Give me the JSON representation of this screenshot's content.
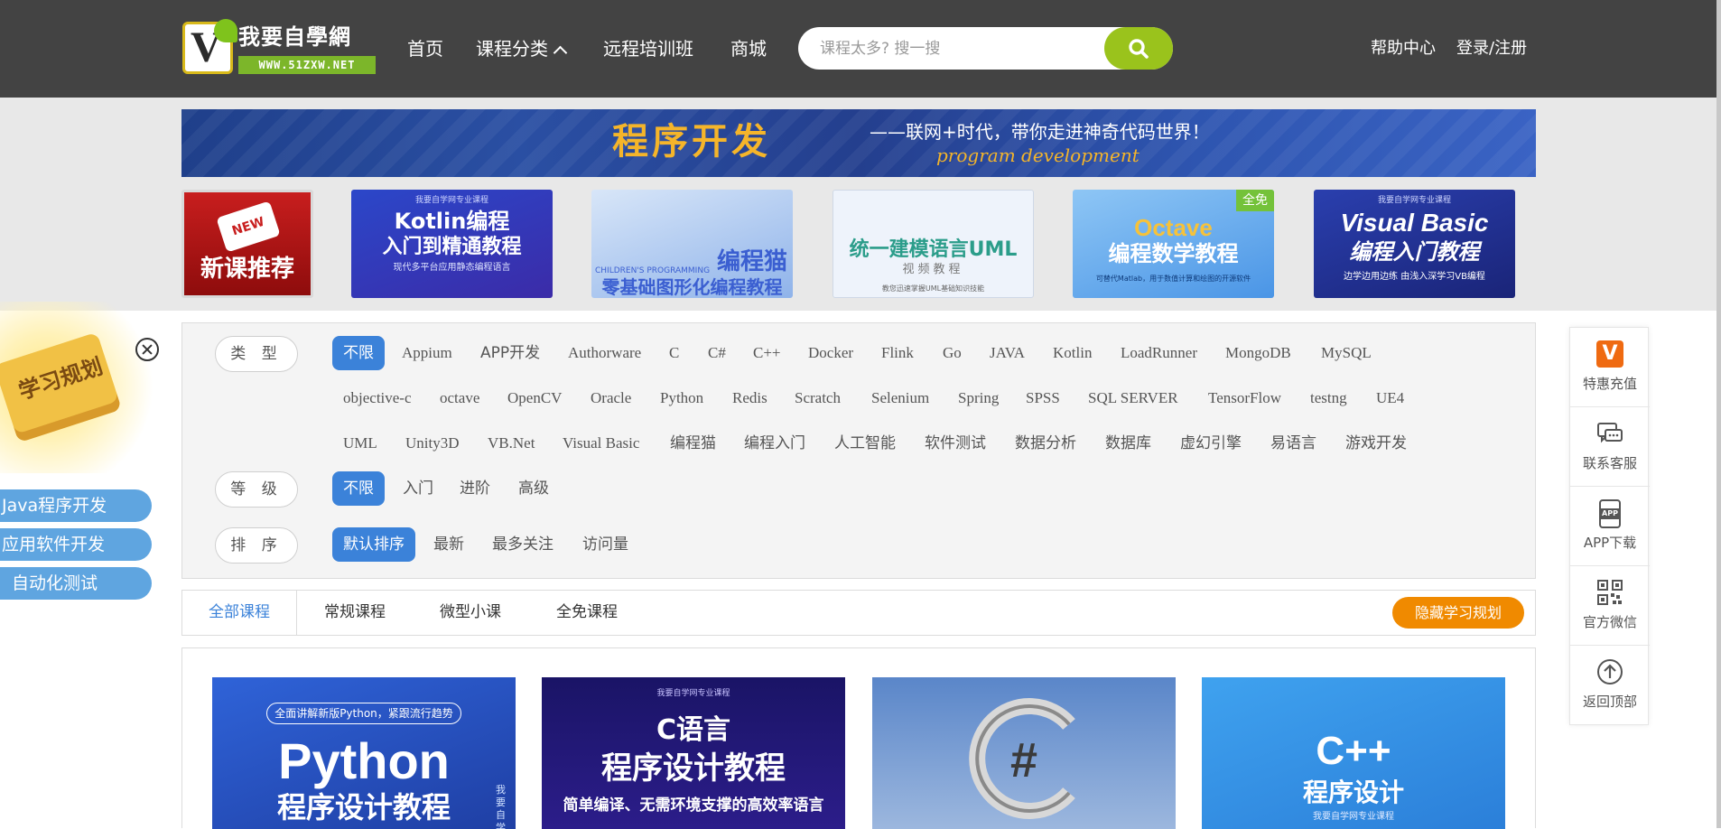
{
  "header": {
    "logo": {
      "name": "我要自學網",
      "url": "WWW.51ZXW.NET"
    },
    "nav": [
      {
        "label": "首页"
      },
      {
        "label": "课程分类"
      },
      {
        "label": "远程培训班"
      },
      {
        "label": "商城"
      }
    ],
    "search": {
      "placeholder": "课程太多? 搜一搜"
    },
    "help": "帮助中心",
    "login": "登录/注册"
  },
  "banner": {
    "title": "程序开发",
    "subtitle": "——联网+时代，带你走进神奇代码世界！",
    "subtitle_en": "program development"
  },
  "thumbnails": [
    {
      "tag": "NEW",
      "label": "新课推荐"
    },
    {
      "line1": "Kotlin编程",
      "line2": "入门到精通教程",
      "line3": "现代多平台应用静态编程语言",
      "top": "我要自学网专业课程"
    },
    {
      "line1": "编程猫",
      "line2": "零基础图形化编程教程",
      "line3": "CHILDREN'S PROGRAMMING"
    },
    {
      "line1": "统一建模语言UML",
      "line2": "视频教程",
      "line3": "教您迅速掌握UML基础知识技能"
    },
    {
      "line1": "Octave",
      "line2": "编程数学教程",
      "line3": "可替代Matlab，用于数值计算和绘图的开源软件",
      "badge": "全免"
    },
    {
      "line1": "Visual Basic",
      "line2": "编程入门教程",
      "line3": "边学边用边练 由浅入深学习VB编程",
      "top": "我要自学网专业课程"
    }
  ],
  "plan": {
    "book": "学习规划",
    "items": [
      "Java程序开发",
      "应用软件开发",
      "自动化测试"
    ]
  },
  "filters": {
    "type_label": "类 型",
    "types": [
      "不限",
      "Appium",
      "APP开发",
      "Authorware",
      "C",
      "C#",
      "C++",
      "Docker",
      "Flink",
      "Go",
      "JAVA",
      "Kotlin",
      "LoadRunner",
      "MongoDB",
      "MySQL",
      "objective-c",
      "octave",
      "OpenCV",
      "Oracle",
      "Python",
      "Redis",
      "Scratch",
      "Selenium",
      "Spring",
      "SPSS",
      "SQL SERVER",
      "TensorFlow",
      "testng",
      "UE4",
      "UML",
      "Unity3D",
      "VB.Net",
      "Visual Basic",
      "编程猫",
      "编程入门",
      "人工智能",
      "软件测试",
      "数据分析",
      "数据库",
      "虚幻引擎",
      "易语言",
      "游戏开发"
    ],
    "level_label": "等 级",
    "levels": [
      "不限",
      "入门",
      "进阶",
      "高级"
    ],
    "sort_label": "排 序",
    "sorts": [
      "默认排序",
      "最新",
      "最多关注",
      "访问量"
    ]
  },
  "tabs": {
    "items": [
      "全部课程",
      "常规课程",
      "微型小课",
      "全免课程"
    ],
    "hide_plan": "隐藏学习规划"
  },
  "courses": [
    {
      "top": "全面讲解新版Python，紧跟流行趋势",
      "title": "Python",
      "subtitle": "程序设计教程",
      "side": "我要自学"
    },
    {
      "top": "我要自学网专业课程",
      "title": "C语言",
      "subtitle": "程序设计教程",
      "tagline": "简单编译、无需环境支撑的高效率语言"
    },
    {
      "title": "#"
    },
    {
      "title": "C++",
      "subtitle": "程序设计",
      "tagline": "我要自学网专业课程"
    }
  ],
  "sidebar": [
    {
      "label": "特惠充值",
      "icon": "v-badge-icon",
      "glyph": "V"
    },
    {
      "label": "联系客服",
      "icon": "chat-icon"
    },
    {
      "label": "APP下载",
      "icon": "app-download-icon",
      "glyph": "APP"
    },
    {
      "label": "官方微信",
      "icon": "qr-code-icon"
    },
    {
      "label": "返回顶部",
      "icon": "arrow-up-icon"
    }
  ],
  "colors": {
    "header_bg": "#434343",
    "accent_green": "#9ac31c",
    "accent_blue": "#3b82d9",
    "accent_orange": "#f08a00"
  }
}
